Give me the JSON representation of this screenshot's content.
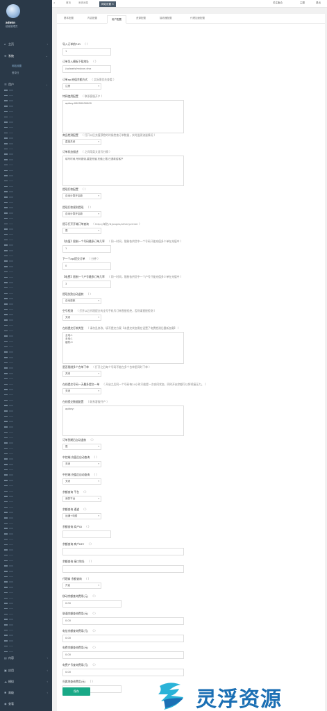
{
  "sidebar": {
    "user": {
      "name": "admin",
      "role": "超级管理员"
    },
    "sections": [
      {
        "label": "主页",
        "icon": "home-icon"
      },
      {
        "label": "系统",
        "icon": "gear-icon"
      },
      {
        "label": "用户",
        "icon": "user-icon"
      }
    ],
    "system_subitems": [
      "网站设置",
      "登录日"
    ],
    "bottom_sections": [
      {
        "label": "内容",
        "icon": "folder-icon"
      },
      {
        "label": "应用",
        "icon": "app-icon"
      },
      {
        "label": "模拟",
        "icon": "cloud-icon"
      },
      {
        "label": "高级",
        "icon": "gear-icon"
      },
      {
        "label": "查看",
        "icon": "eye-icon"
      }
    ]
  },
  "topbar": {
    "tabs": [
      "首页",
      "系统消息",
      "网站设置"
    ],
    "right": [
      "关注聚合",
      "主题",
      "退出"
    ]
  },
  "subtabs": [
    "基本配置",
    "内容配置",
    "用户配置",
    "资源配置",
    "接收器配置",
    "代理加速配置"
  ],
  "form": {
    "f01": {
      "label": "导入订单前P.ID",
      "hint": "（ ）",
      "value": "1"
    },
    "f02": {
      "label": "订单导入模板下载地址",
      "hint": "（ ）",
      "value": "/uploads/muban.xlsx"
    },
    "f03": {
      "label": "订单api充值余额方式",
      "hint": "（ 实际需优先查看 ）",
      "value": "注册"
    },
    "f04": {
      "label": "特网使用配置",
      "hint": "（ 联系客服开户 ）",
      "value": "apikey:00000000000"
    },
    "f05": {
      "label": "商品检测配置",
      "hint": "（ 打开以后充值预检的时候检查订单数量，实时监测流量情况 ）",
      "value": "直接关闭"
    },
    "f06": {
      "label": "订单状态描述",
      "hint": "（ 之间用英文逗号分隔 ）",
      "value": "填写时间,号码错误,重复充值,充值上限,已退款给客户"
    },
    "f07": {
      "label": "提现打款配置",
      "hint": "（ ）",
      "value": "自动计算开启款"
    },
    "f08": {
      "label": "提现打款规则提现",
      "hint": "（ ）",
      "value": "自动计算开启款"
    },
    "f09": {
      "label": "提示打开开端订单查询",
      "hint": "（ http://域名/#/pages/other/printer ）",
      "value": "是"
    },
    "f10": {
      "label": "【充值】限制一个号码最多订单几率",
      "hint": "（ 同一时间，限制各供货中一个号码只能充值多少单在充值中 ）",
      "value": "1"
    },
    "f11": {
      "label": "下一个api提交订单",
      "hint": "（ 分钟 ）",
      "value": "0"
    },
    "f12": {
      "label": "【电费】限制一个户号最多订单几率",
      "hint": "（ 同一时间，限制各供货中一个户号只能充值多少单在充值中 ）",
      "value": "3"
    },
    "f13": {
      "label": "提现失败自动退款",
      "hint": "（ ）",
      "value": "自动退款"
    },
    "f14": {
      "label": "空号检测",
      "hint": "（ 打开以后代理提交的全号手机号订单直接拒绝，否则请直接检测 ）",
      "value": "关闭"
    },
    "f15": {
      "label": "在线提交打款类型",
      "hint": "（ 请勿乱修改，填写提交方案【未提交状态需在设置了电费检测后重新加载】 ）",
      "value": "全电:1\n未电:1\n缓机:0"
    },
    "f16": {
      "label": "是否限制多个合单下单",
      "hint": "（ 打开之后每个号码不能在多个合单里同时下单 ）",
      "value": "关闭"
    },
    "f17": {
      "label": "在线提交号码一天最多提交一单",
      "hint": "（ 开启之后同一个号码每24小时只能提一次合同状态，同时开启余额可以将续接压力。 ）",
      "value": "关闭"
    },
    "f18": {
      "label": "在线提交数据配置",
      "hint": "（ 联系客服开户 ）",
      "value": "apikey:"
    },
    "f19": {
      "label": "订单到期后自动退款",
      "hint": "（ ）",
      "value": "是"
    },
    "f20": {
      "label": "中控端 充值后自动查询",
      "hint": "（ ）",
      "value": "关闭"
    },
    "f21": {
      "label": "中控端 充值后自动查询",
      "hint": "（ ）",
      "value": "关闭"
    },
    "f22": {
      "label": "余额查询 平台",
      "hint": "（ ）",
      "value": "我的平台"
    },
    "f23": {
      "label": "余额查询 通道",
      "hint": "（ ）",
      "value": "运通+电费"
    },
    "f24": {
      "label": "余额查询 商户ID",
      "hint": "（ ）",
      "value": ""
    },
    "f25": {
      "label": "余额查询 商户KEY",
      "hint": "（ ）",
      "value": ""
    },
    "f26": {
      "label": "余额查询 接口地址",
      "hint": "（ ）",
      "value": ""
    },
    "f27": {
      "label": "代理商 余额查询",
      "hint": "（ ）",
      "value": "开启"
    },
    "f28": {
      "label": "移动余额查询费用(元)",
      "hint": "（ ）",
      "value": "0.00"
    },
    "f29": {
      "label": "联通余额查询费用(元)",
      "hint": "（ ）",
      "value": "0.00"
    },
    "f30": {
      "label": "电信余额查询费用(元)",
      "hint": "（ ）",
      "value": "0.00"
    },
    "f31": {
      "label": "电费余额查询费用(元)",
      "hint": "（ ）",
      "value": "0.00"
    },
    "f32": {
      "label": "电费户号查询费用(元)",
      "hint": "（ ）",
      "value": "0.00"
    },
    "f33": {
      "label": "归属地查询费用(元)",
      "hint": "（ ）",
      "value": "0.00"
    }
  },
  "save_label": "保存",
  "watermark": {
    "text": "灵浮资源"
  }
}
